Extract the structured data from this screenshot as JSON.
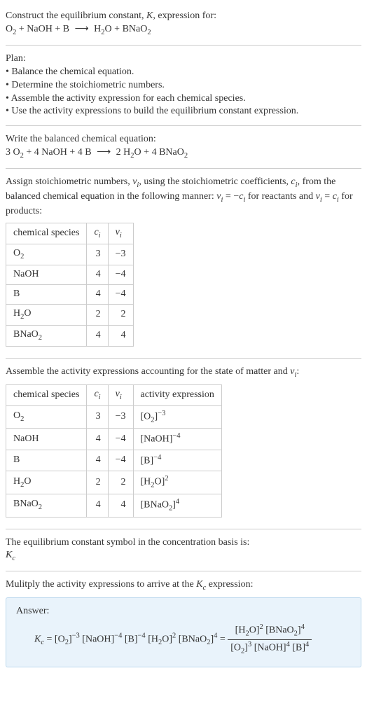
{
  "header": {
    "construct_line": "Construct the equilibrium constant, ",
    "k_sym": "K",
    "construct_tail": ", expression for:",
    "unbalanced_lhs_o2": "O",
    "unbalanced_lhs_o2sub": "2",
    "plus": " + ",
    "naoh": "NaOH",
    "b": "B",
    "arrow": "⟶",
    "h2o": "H",
    "h2o_sub": "2",
    "h2o_o": "O",
    "bnao2_b": "BNaO",
    "bnao2_sub": "2"
  },
  "plan": {
    "title": "Plan:",
    "b1": "• Balance the chemical equation.",
    "b2": "• Determine the stoichiometric numbers.",
    "b3": "• Assemble the activity expression for each chemical species.",
    "b4": "• Use the activity expressions to build the equilibrium constant expression."
  },
  "balanced": {
    "intro": "Write the balanced chemical equation:",
    "c1": "3 ",
    "c2": "4 ",
    "c3": "4 ",
    "c4": "2 ",
    "c5": "4 "
  },
  "assign": {
    "line1a": "Assign stoichiometric numbers, ",
    "nu": "ν",
    "sub_i": "i",
    "line1b": ", using the stoichiometric coefficients, ",
    "c": "c",
    "line1c": ", from the balanced chemical equation in the following manner: ",
    "rel1a": " = −",
    "rel_tail": " for reactants and ",
    "rel2a": " = ",
    "rel2_tail": " for products:"
  },
  "table1": {
    "h_species": "chemical species",
    "h_c": "c",
    "h_nu": "ν",
    "rows": [
      {
        "sp_a": "O",
        "sp_sub": "2",
        "c": "3",
        "nu": "−3"
      },
      {
        "sp_a": "NaOH",
        "sp_sub": "",
        "c": "4",
        "nu": "−4"
      },
      {
        "sp_a": "B",
        "sp_sub": "",
        "c": "4",
        "nu": "−4"
      },
      {
        "sp_a": "H",
        "sp_sub": "2",
        "sp_b": "O",
        "c": "2",
        "nu": "2"
      },
      {
        "sp_a": "BNaO",
        "sp_sub": "2",
        "c": "4",
        "nu": "4"
      }
    ]
  },
  "assemble": {
    "intro_a": "Assemble the activity expressions accounting for the state of matter and ",
    "intro_b": ":"
  },
  "table2": {
    "h_species": "chemical species",
    "h_c": "c",
    "h_nu": "ν",
    "h_act": "activity expression",
    "rows": [
      {
        "sp_a": "O",
        "sp_sub": "2",
        "c": "3",
        "nu": "−3",
        "act_a": "[O",
        "act_sub": "2",
        "act_b": "]",
        "act_sup": "−3"
      },
      {
        "sp_a": "NaOH",
        "sp_sub": "",
        "c": "4",
        "nu": "−4",
        "act_a": "[NaOH]",
        "act_sub": "",
        "act_b": "",
        "act_sup": "−4"
      },
      {
        "sp_a": "B",
        "sp_sub": "",
        "c": "4",
        "nu": "−4",
        "act_a": "[B]",
        "act_sub": "",
        "act_b": "",
        "act_sup": "−4"
      },
      {
        "sp_a": "H",
        "sp_sub": "2",
        "sp_b": "O",
        "c": "2",
        "nu": "2",
        "act_a": "[H",
        "act_sub": "2",
        "act_b": "O]",
        "act_sup": "2"
      },
      {
        "sp_a": "BNaO",
        "sp_sub": "2",
        "c": "4",
        "nu": "4",
        "act_a": "[BNaO",
        "act_sub": "2",
        "act_b": "]",
        "act_sup": "4"
      }
    ]
  },
  "kc_line": {
    "a": "The equilibrium constant symbol in the concentration basis is:",
    "sym": "K",
    "sub": "c"
  },
  "mult": {
    "a": "Mulitply the activity expressions to arrive at the ",
    "b": " expression:"
  },
  "answer": {
    "label": "Answer:",
    "kc": "K",
    "kc_sub": "c",
    "eq": " = ",
    "lhs": {
      "t1a": "[O",
      "t1s": "2",
      "t1b": "]",
      "t1e": "−3",
      "t2a": " [NaOH]",
      "t2e": "−4",
      "t3a": " [B]",
      "t3e": "−4",
      "t4a": " [H",
      "t4s": "2",
      "t4b": "O]",
      "t4e": "2",
      "t5a": " [BNaO",
      "t5s": "2",
      "t5b": "]",
      "t5e": "4"
    },
    "rhs_num": {
      "t1a": "[H",
      "t1s": "2",
      "t1b": "O]",
      "t1e": "2",
      "t2a": " [BNaO",
      "t2s": "2",
      "t2b": "]",
      "t2e": "4"
    },
    "rhs_den": {
      "t1a": "[O",
      "t1s": "2",
      "t1b": "]",
      "t1e": "3",
      "t2a": " [NaOH]",
      "t2e": "4",
      "t3a": " [B]",
      "t3e": "4"
    }
  }
}
